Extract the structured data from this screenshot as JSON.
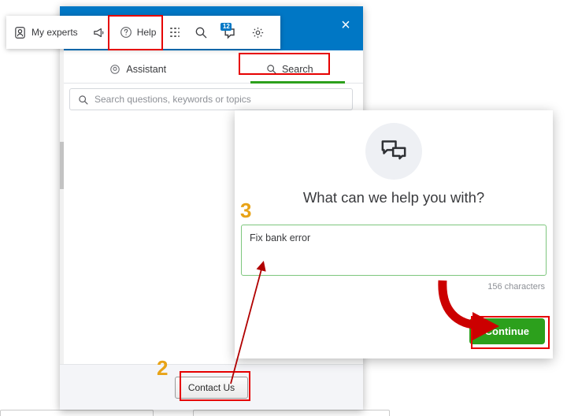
{
  "toolbar": {
    "items": [
      {
        "label": "My experts",
        "icon": "person-icon"
      },
      {
        "label": "",
        "icon": "megaphone-icon"
      },
      {
        "label": "Help",
        "icon": "help-circle-icon"
      },
      {
        "label": "",
        "icon": "grid-apps-icon"
      },
      {
        "label": "",
        "icon": "search-icon"
      },
      {
        "label": "",
        "icon": "notifications-icon",
        "badge": "12"
      },
      {
        "label": "",
        "icon": "gear-icon"
      }
    ],
    "badge_count": "12"
  },
  "panel": {
    "close_label": "×",
    "header_color": "#0077c5",
    "tabs": [
      {
        "label": "Assistant",
        "icon": "assistant-icon",
        "active": false
      },
      {
        "label": "Search",
        "icon": "search-icon",
        "active": true
      }
    ],
    "search": {
      "placeholder": "Search questions, keywords or topics",
      "value": ""
    },
    "footer": {
      "contact_label": "Contact Us"
    }
  },
  "modal": {
    "icon": "chat-bubbles-icon",
    "title": "What can we help you with?",
    "textarea": {
      "value": "Fix bank error",
      "placeholder": ""
    },
    "char_count": "156 characters",
    "continue_label": "Continue"
  },
  "annotations": {
    "step2": "2",
    "step3": "3",
    "highlight_color": "#e60000",
    "number_color": "#e8a317",
    "accent_green": "#2ca01c"
  }
}
